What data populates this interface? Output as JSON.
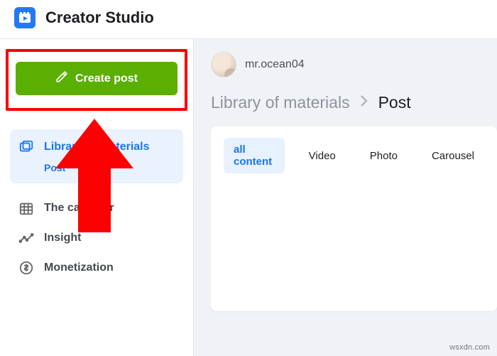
{
  "header": {
    "title": "Creator Studio"
  },
  "sidebar": {
    "create_label": "Create post",
    "active_item": {
      "label": "Library of materials",
      "sub": "Post"
    },
    "items": [
      {
        "label": "The calendar"
      },
      {
        "label": "Insight"
      },
      {
        "label": "Monetization"
      }
    ]
  },
  "main": {
    "username": "mr.ocean04",
    "breadcrumb": {
      "root": "Library of materials",
      "leaf": "Post"
    },
    "tabs": [
      {
        "label": "all content",
        "active": true
      },
      {
        "label": "Video",
        "active": false
      },
      {
        "label": "Photo",
        "active": false
      },
      {
        "label": "Carousel",
        "active": false
      }
    ]
  },
  "watermark": "wsxdn.com"
}
